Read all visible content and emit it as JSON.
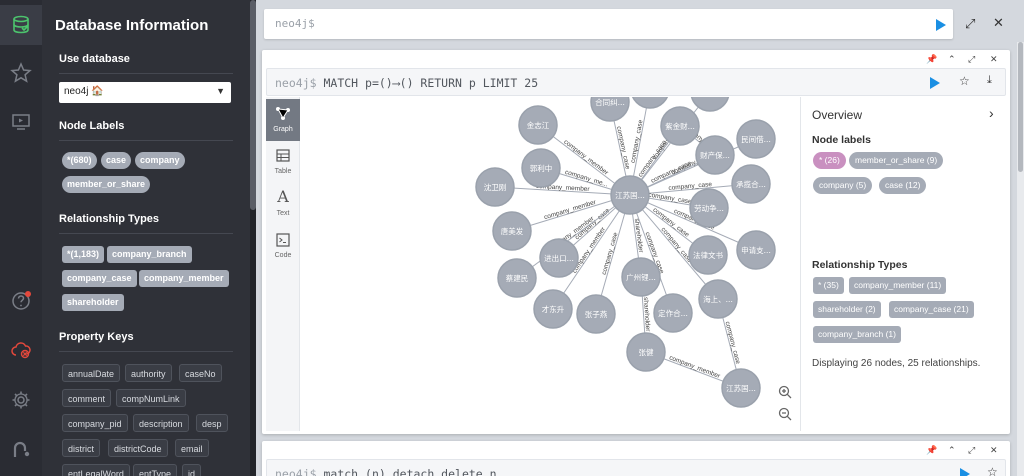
{
  "drawer": {
    "title": "Database Information",
    "use_database": "Use database",
    "selected_db": "neo4j 🏠",
    "node_labels_heading": "Node Labels",
    "node_labels": [
      "*(680)",
      "case",
      "company",
      "member_or_share"
    ],
    "rel_types_heading": "Relationship Types",
    "rel_types": [
      "*(1,183)",
      "company_branch",
      "company_case",
      "company_member",
      "shareholder"
    ],
    "prop_keys_heading": "Property Keys",
    "prop_keys": [
      "annualDate",
      "authority",
      "caseNo",
      "comment",
      "compNumLink",
      "company_pid",
      "description",
      "desp",
      "district",
      "districtCode",
      "email",
      "entLegalWord",
      "entType",
      "id"
    ]
  },
  "editor": {
    "prompt": "neo4j$"
  },
  "frame1": {
    "prompt": "neo4j$",
    "query": "MATCH p=()⟶() RETURN p LIMIT 25",
    "tabs": [
      "Graph",
      "Table",
      "Text",
      "Code"
    ]
  },
  "overview": {
    "title": "Overview",
    "node_labels_heading": "Node labels",
    "node_labels": [
      "* (26)",
      "member_or_share (9)",
      "company (5)",
      "case (12)"
    ],
    "rel_types_heading": "Relationship Types",
    "rel_types": [
      "* (35)",
      "company_member (11)",
      "shareholder (2)",
      "company_case (21)",
      "company_branch (1)"
    ],
    "status": "Displaying 26 nodes, 25 relationships."
  },
  "frame2": {
    "prompt": "neo4j$",
    "query": "match (n) detach delete n"
  },
  "graph": {
    "nodes": [
      {
        "id": "hub",
        "label": "江苏国..."
      },
      {
        "id": "n1",
        "label": "合同纠..."
      },
      {
        "id": "n2",
        "label": ""
      },
      {
        "id": "n3",
        "label": ""
      },
      {
        "id": "n4",
        "label": "紫金财..."
      },
      {
        "id": "n5",
        "label": "民间借..."
      },
      {
        "id": "n6",
        "label": "金志江"
      },
      {
        "id": "n7",
        "label": "郭利中"
      },
      {
        "id": "n8",
        "label": "财产保..."
      },
      {
        "id": "n9",
        "label": "承揽合..."
      },
      {
        "id": "n10",
        "label": "沈卫刚"
      },
      {
        "id": "n11",
        "label": "劳动争..."
      },
      {
        "id": "n12",
        "label": "唐美发"
      },
      {
        "id": "n13",
        "label": "进出口..."
      },
      {
        "id": "n14",
        "label": "法律文书"
      },
      {
        "id": "n15",
        "label": "申请支..."
      },
      {
        "id": "n16",
        "label": "蔡建民"
      },
      {
        "id": "n17",
        "label": "广州锂..."
      },
      {
        "id": "n18",
        "label": "海上、..."
      },
      {
        "id": "n19",
        "label": "才东升"
      },
      {
        "id": "n20",
        "label": "张子燕"
      },
      {
        "id": "n21",
        "label": "定作合..."
      },
      {
        "id": "n22",
        "label": "张健"
      },
      {
        "id": "n23",
        "label": "江苏国..."
      }
    ],
    "edges": [
      {
        "from": "n6",
        "to": "hub",
        "label": "company_member"
      },
      {
        "from": "n7",
        "to": "hub",
        "label": "company_me..."
      },
      {
        "from": "n10",
        "to": "hub",
        "label": "company_member"
      },
      {
        "from": "n12",
        "to": "hub",
        "label": "company_member"
      },
      {
        "from": "n13",
        "to": "hub",
        "label": "company_case"
      },
      {
        "from": "n16",
        "to": "hub",
        "label": "company_member"
      },
      {
        "from": "n19",
        "to": "hub",
        "label": "company_member"
      },
      {
        "from": "n20",
        "to": "hub",
        "label": "company_case"
      },
      {
        "from": "n17",
        "to": "hub",
        "label": "shareholder"
      },
      {
        "from": "hub",
        "to": "n1",
        "label": "company_case"
      },
      {
        "from": "hub",
        "to": "n2",
        "label": "company_case"
      },
      {
        "from": "hub",
        "to": "n3",
        "label": "company_case"
      },
      {
        "from": "hub",
        "to": "n4",
        "label": "company_case"
      },
      {
        "from": "hub",
        "to": "n5",
        "label": "company_case"
      },
      {
        "from": "hub",
        "to": "n8",
        "label": "company_case"
      },
      {
        "from": "hub",
        "to": "n9",
        "label": "company_case"
      },
      {
        "from": "hub",
        "to": "n11",
        "label": "company_case"
      },
      {
        "from": "hub",
        "to": "n14",
        "label": "company_case"
      },
      {
        "from": "hub",
        "to": "n15",
        "label": "company_case"
      },
      {
        "from": "hub",
        "to": "n18",
        "label": "company_case"
      },
      {
        "from": "hub",
        "to": "n21",
        "label": "company_case"
      },
      {
        "from": "n22",
        "to": "n23",
        "label": "company_member"
      },
      {
        "from": "n18",
        "to": "n23",
        "label": "company_case"
      },
      {
        "from": "n17",
        "to": "n22",
        "label": "shareholder"
      },
      {
        "from": "n4",
        "to": "n8",
        "label": "company_case"
      }
    ]
  },
  "colors": {
    "node_fill": "#a5abb6",
    "node_stroke": "#9aa1ac",
    "accent_blue": "#1a8fe3",
    "pink_tag": "#c990c0",
    "notification_red": "#e3483c"
  }
}
